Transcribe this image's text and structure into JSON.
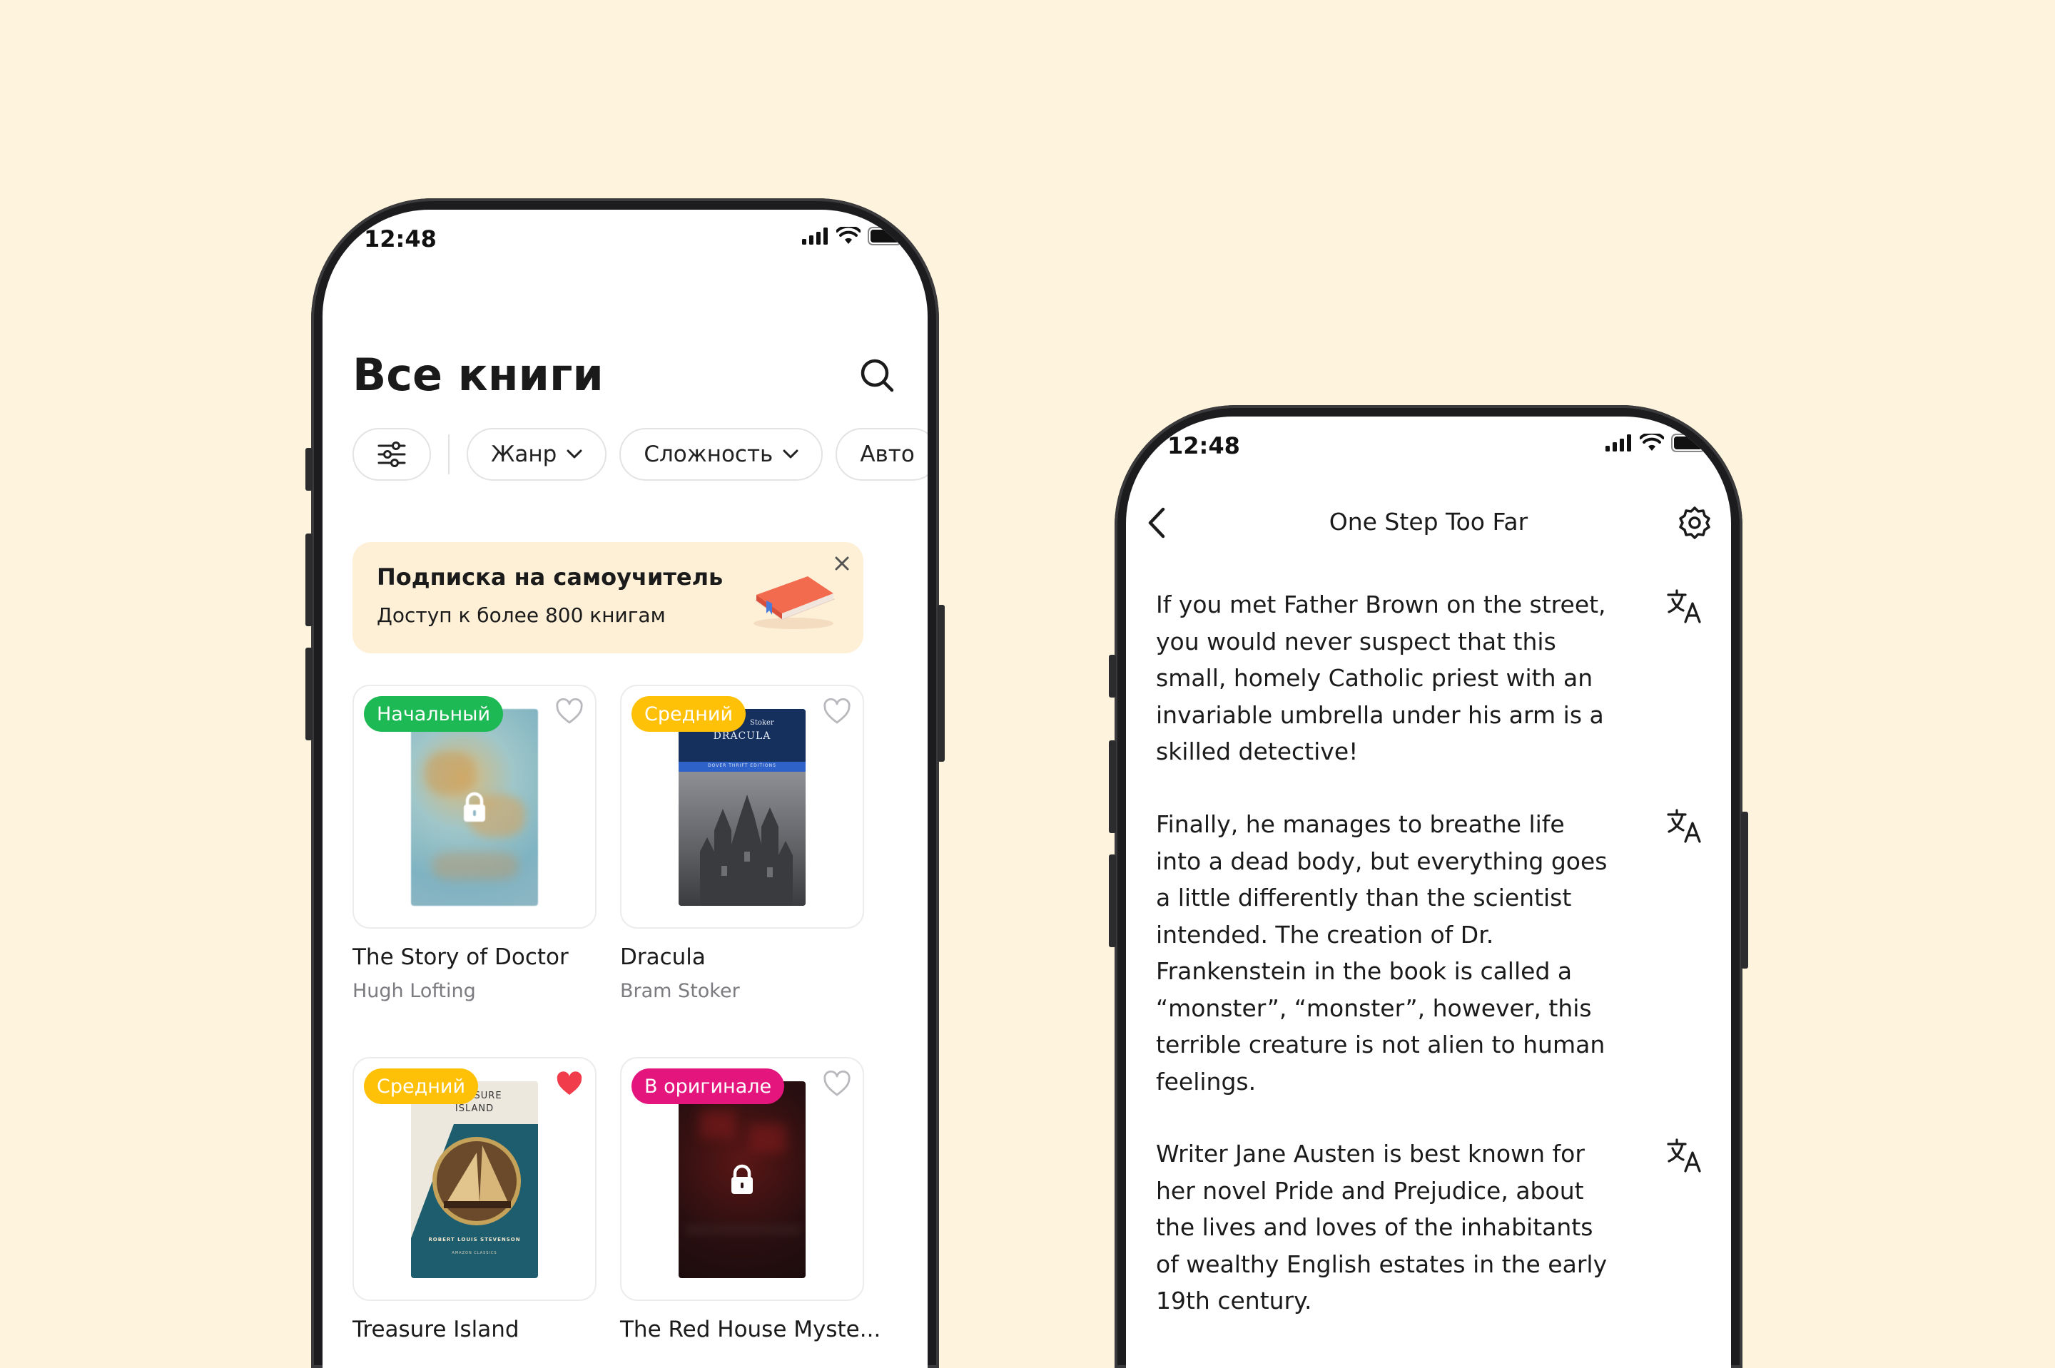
{
  "colors": {
    "background": "#FEF3DC",
    "badge_beginner": "#1DB954",
    "badge_intermediate": "#FFC107",
    "badge_original": "#E5157E",
    "heart_active": "#F03C4B",
    "banner_bg": "#FEF0D6"
  },
  "catalog": {
    "status_time": "12:48",
    "title": "Все книги",
    "filters": [
      "Жанр",
      "Сложность",
      "Авто"
    ],
    "banner": {
      "title": "Подписка на самоучитель",
      "subtitle": "Доступ к более 800 книгам"
    },
    "books": [
      {
        "title": "The Story of Doctor",
        "author": "Hugh Lofting",
        "badge": "Начальный",
        "favorite": false,
        "locked": true
      },
      {
        "title": "Dracula",
        "author": "Bram Stoker",
        "badge": "Средний",
        "favorite": false,
        "locked": false,
        "cover_text": [
          "Stoker",
          "DRACULA",
          "DOVER THRIFT EDITIONS"
        ]
      },
      {
        "title": "Treasure Island",
        "author": "",
        "badge": "Средний",
        "favorite": true,
        "locked": false,
        "cover_text": [
          "TREASURE",
          "ISLAND",
          "ROBERT LOUIS STEVENSON",
          "AMAZON CLASSICS"
        ]
      },
      {
        "title": "The Red House Myste...",
        "author": "",
        "badge": "В оригинале",
        "favorite": false,
        "locked": true
      }
    ]
  },
  "reader": {
    "status_time": "12:48",
    "title": "One Step Too Far",
    "paragraphs": [
      "If you met Father Brown on the street, you would never suspect that this small, homely Catholic priest with an invariable umbrella under his arm is a skilled detective!",
      "Finally, he manages to breathe life into a dead body, but everything goes a little differently than the scientist intended. The creation of Dr. Frankenstein in the book is called a “monster”, “monster”, however, this terrible creature is not alien to human feelings.",
      "Writer Jane Austen is best known for her novel Pride and Prejudice, about the lives and loves of the inhabitants of wealthy English estates in the early 19th century."
    ]
  }
}
